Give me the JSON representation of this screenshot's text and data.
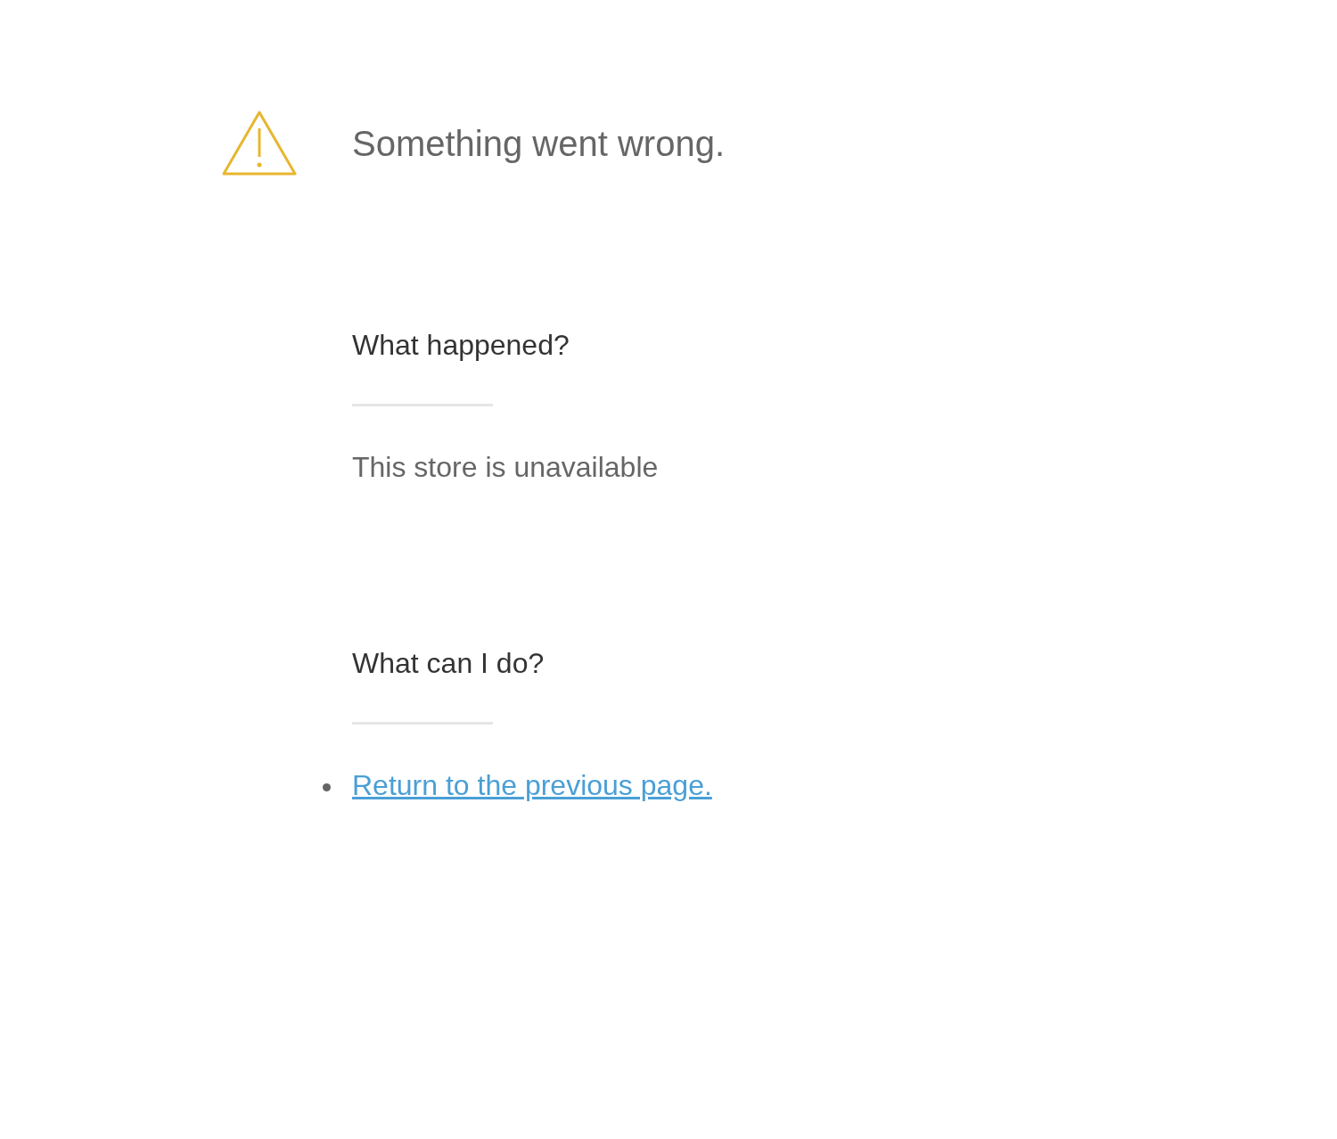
{
  "title": "Something went wrong.",
  "sections": [
    {
      "heading": "What happened?",
      "kind": "text",
      "body": "This store is unavailable"
    },
    {
      "heading": "What can I do?",
      "kind": "links",
      "links": [
        "Return to the previous page."
      ]
    }
  ]
}
